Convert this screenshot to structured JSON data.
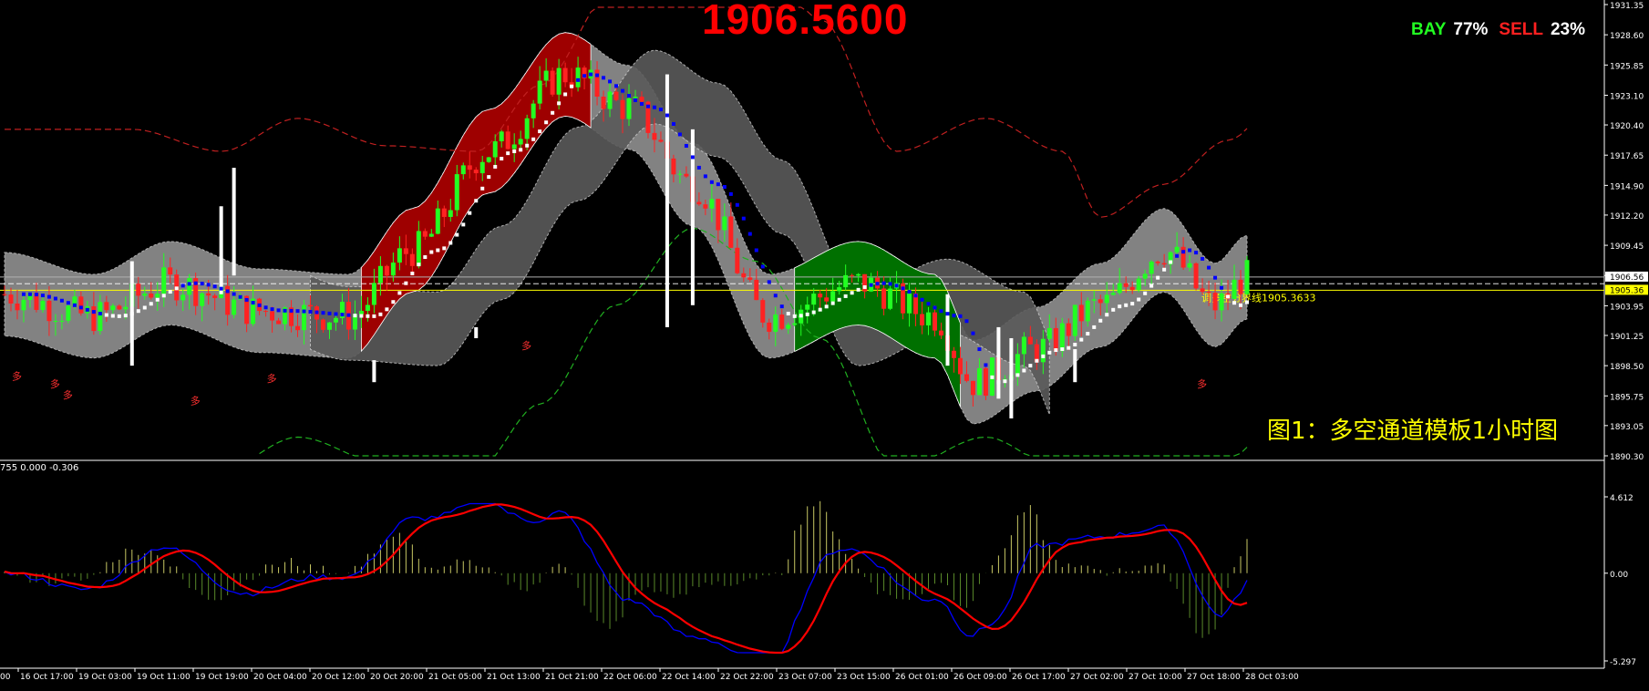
{
  "price_label": "1906.5600",
  "ratio_panel": {
    "bay_label": "BAY",
    "bay_pct": "77%",
    "sell_label": "SELL",
    "sell_pct": "23%"
  },
  "caption": "图1：多空通道模板1小时图",
  "indicator_label": "755 0.000 -0.306",
  "boundary_label": "调多空分界线1905.3633",
  "colors": {
    "background": "#000000",
    "bull_candle": "#22ff22",
    "bear_candle": "#ff2222",
    "channel_gray": "#999999",
    "red_zone": "#9e0000",
    "green_zone": "#007000",
    "ma_up": "#ffffff",
    "ma_down": "#0000ff",
    "macd_fast": "#0000ff",
    "macd_slow": "#ff0000",
    "hist_pos": "#c8c864",
    "hist_neg": "#5a8a2a",
    "label_yellow": "#ffff00"
  },
  "chart_data": {
    "type": "candlestick",
    "price_axis": {
      "ticks": [
        "1931.35",
        "1928.60",
        "1925.85",
        "1923.10",
        "1920.40",
        "1917.65",
        "1914.90",
        "1912.20",
        "1909.45",
        "1906.70",
        "1903.95",
        "1901.25",
        "1898.50",
        "1895.75",
        "1893.05",
        "1890.30"
      ],
      "markers": [
        {
          "value": "1906.56",
          "color": "#ffffff"
        },
        {
          "value": "1905.36",
          "color": "#ffff00"
        }
      ],
      "range": [
        1890.3,
        1931.35
      ]
    },
    "indicator_axis": {
      "ticks": [
        "4.612",
        "0.00",
        "-5.297"
      ],
      "range": [
        -5.297,
        4.612
      ]
    },
    "time_axis": [
      "16 Oct 17:00",
      "19 Oct 03:00",
      "19 Oct 11:00",
      "19 Oct 19:00",
      "20 Oct 04:00",
      "20 Oct 12:00",
      "20 Oct 20:00",
      "21 Oct 05:00",
      "21 Oct 13:00",
      "21 Oct 21:00",
      "22 Oct 06:00",
      "22 Oct 14:00",
      "22 Oct 22:00",
      "23 Oct 07:00",
      "23 Oct 15:00",
      "26 Oct 01:00",
      "26 Oct 09:00",
      "26 Oct 17:00",
      "27 Oct 02:00",
      "27 Oct 10:00",
      "27 Oct 18:00",
      "28 Oct 03:00"
    ],
    "time_axis_partial_left": "00",
    "arrow_labels": [
      "多",
      "多",
      "多",
      "多",
      "多",
      "多",
      "多"
    ]
  }
}
